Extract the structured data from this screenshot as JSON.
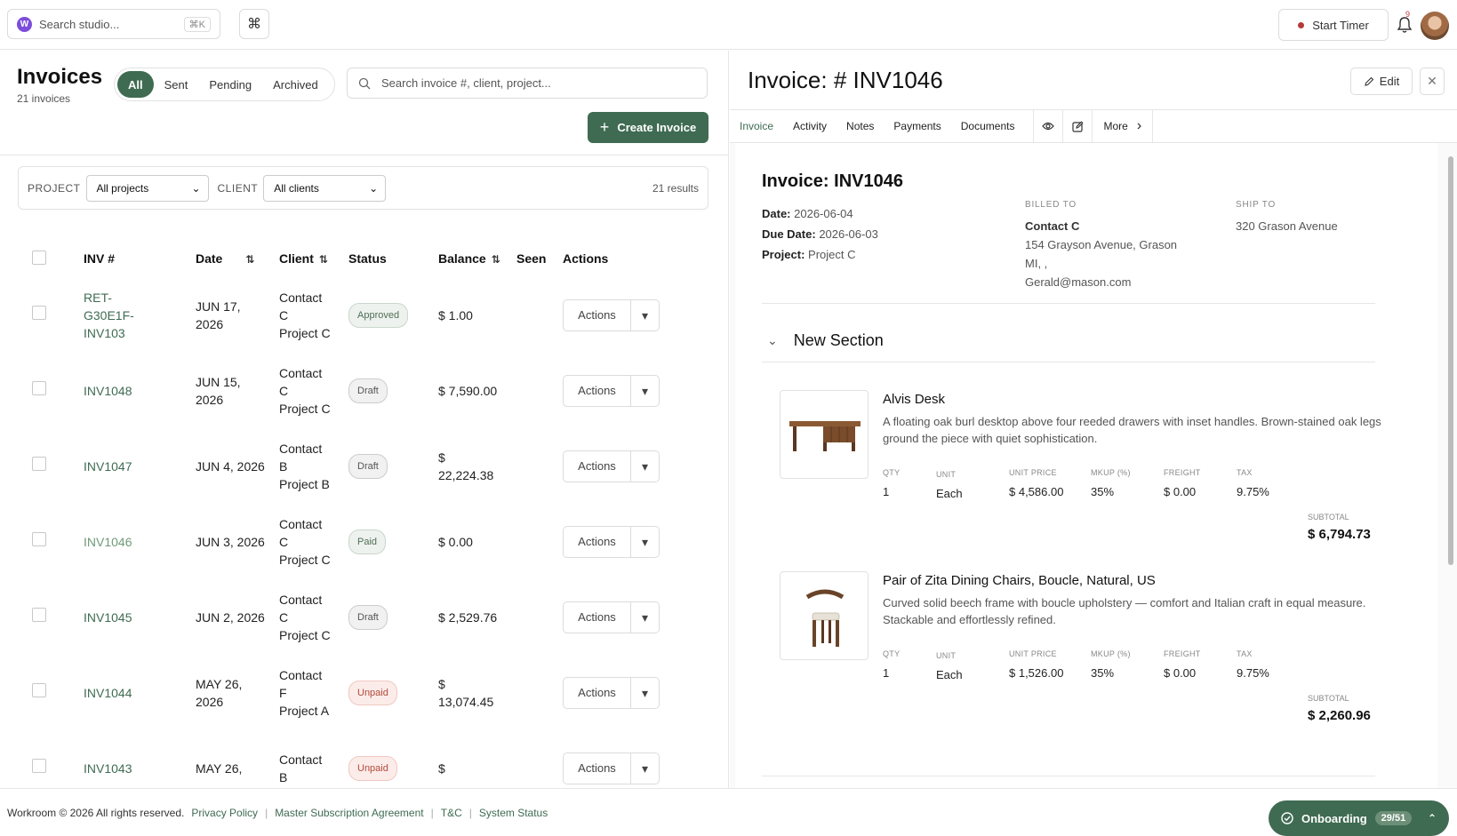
{
  "topbar": {
    "search_placeholder": "Search studio...",
    "shortcut": "⌘K",
    "logo_letter": "W",
    "command_icon": "⌘",
    "timer_label": "Start Timer",
    "notif_count": "9"
  },
  "list": {
    "title": "Invoices",
    "count_label": "21 invoices",
    "segments": [
      "All",
      "Sent",
      "Pending",
      "Archived"
    ],
    "search_placeholder": "Search invoice #, client, project...",
    "create_label": "Create Invoice",
    "filters": {
      "project_label": "PROJECT",
      "project_value": "All projects",
      "client_label": "CLIENT",
      "client_value": "All clients",
      "results": "21 results"
    },
    "columns": [
      "INV #",
      "Date",
      "Client",
      "Status",
      "Balance",
      "Seen",
      "Actions"
    ],
    "rows": [
      {
        "inv": "RET-G30E1F-INV103",
        "date": "JUN 17, 2026",
        "client": "Contact C",
        "project": "Project C",
        "status": "Approved",
        "balance": "$ 1.00",
        "actions": "Actions"
      },
      {
        "inv": "INV1048",
        "date": "JUN 15, 2026",
        "client": "Contact C",
        "project": "Project C",
        "status": "Draft",
        "balance": "$ 7,590.00",
        "actions": "Actions"
      },
      {
        "inv": "INV1047",
        "date": "JUN 4, 2026",
        "client": "Contact B",
        "project": "Project B",
        "status": "Draft",
        "balance": "$ 22,224.38",
        "actions": "Actions"
      },
      {
        "inv": "INV1046",
        "date": "JUN 3, 2026",
        "client": "Contact C",
        "project": "Project C",
        "status": "Paid",
        "balance": "$ 0.00",
        "actions": "Actions"
      },
      {
        "inv": "INV1045",
        "date": "JUN 2, 2026",
        "client": "Contact C",
        "project": "Project C",
        "status": "Draft",
        "balance": "$ 2,529.76",
        "actions": "Actions"
      },
      {
        "inv": "INV1044",
        "date": "MAY 26, 2026",
        "client": "Contact F",
        "project": "Project A",
        "status": "Unpaid",
        "balance": "$ 13,074.45",
        "actions": "Actions"
      },
      {
        "inv": "INV1043",
        "date": "MAY 26,",
        "client": "Contact B",
        "project": "",
        "status": "Unpaid",
        "balance": "$",
        "actions": "Actions"
      }
    ]
  },
  "detail": {
    "title": "Invoice: # INV1046",
    "edit_label": "Edit",
    "close_icon": "✕",
    "tabs": [
      "Invoice",
      "Activity",
      "Notes",
      "Payments",
      "Documents"
    ],
    "more_label": "More",
    "doc_title": "Invoice: INV1046",
    "date_label": "Date:",
    "date_value": "2026-06-04",
    "due_label": "Due Date:",
    "due_value": "2026-06-03",
    "project_label": "Project:",
    "project_value": "Project C",
    "billed_to_label": "BILLED TO",
    "billed_name": "Contact C",
    "billed_addr1": "154 Grayson Avenue, Grason",
    "billed_addr2": "MI, ,",
    "billed_email": "Gerald@mason.com",
    "ship_to_label": "SHIP TO",
    "ship_addr": "320 Grason Avenue",
    "section_title": "New Section",
    "field_labels": {
      "qty": "QTY",
      "unit": "UNIT",
      "unit_price": "UNIT PRICE",
      "markup": "MKUP (%)",
      "freight": "FREIGHT",
      "tax": "TAX",
      "subtotal": "SUBTOTAL"
    },
    "items": [
      {
        "name": "Alvis Desk",
        "desc": "A floating oak burl desktop above four reeded drawers with inset handles. Brown-stained oak legs ground the piece with quiet sophistication.",
        "qty": "1",
        "unit": "Each",
        "unit_price": "$ 4,586.00",
        "markup": "35%",
        "freight": "$ 0.00",
        "tax": "9.75%",
        "subtotal": "$ 6,794.73",
        "icon": "desk-image"
      },
      {
        "name": "Pair of Zita Dining Chairs, Boucle, Natural, US",
        "desc": "Curved solid beech frame with boucle upholstery — comfort and Italian craft in equal measure. Stackable and effortlessly refined.",
        "qty": "1",
        "unit": "Each",
        "unit_price": "$ 1,526.00",
        "markup": "35%",
        "freight": "$ 0.00",
        "tax": "9.75%",
        "subtotal": "$ 2,260.96",
        "icon": "chair-image"
      }
    ]
  },
  "footer": {
    "copyright": "Workroom © 2026 All rights reserved.",
    "links": [
      "Privacy Policy",
      "Master Subscription Agreement",
      "T&C",
      "System Status"
    ],
    "onboarding_label": "Onboarding",
    "onboarding_count": "29/51"
  },
  "colors": {
    "accent": "#3f6b52",
    "badge_unpaid": "#b3493a",
    "brand_logo": "#7c4ddb"
  }
}
